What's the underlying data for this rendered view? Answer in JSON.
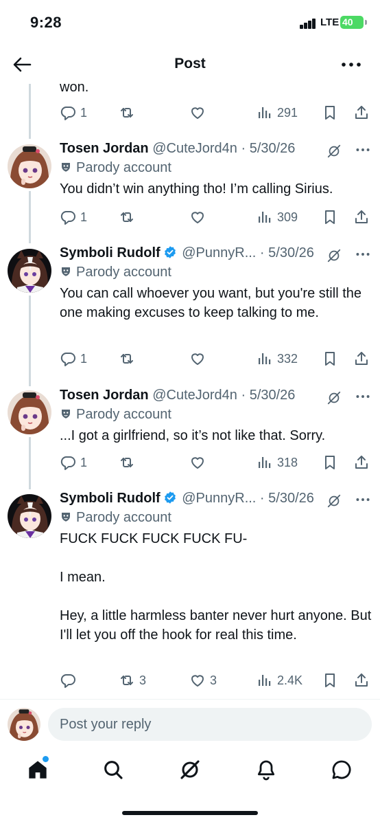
{
  "status_bar": {
    "time": "9:28",
    "network": "LTE",
    "battery": "40"
  },
  "header": {
    "title": "Post"
  },
  "previous_tweet": {
    "text_tail": "won.",
    "actions": {
      "replies": "1",
      "retweets": "",
      "likes": "",
      "views": "291"
    }
  },
  "tweets": [
    {
      "name": "Tosen Jordan",
      "handle": "@CuteJord4n",
      "date": "· 5/30/26",
      "parody": "Parody account",
      "text": "You didn’t win anything tho! I’m calling Sirius.",
      "verified": false,
      "actions": {
        "replies": "1",
        "retweets": "",
        "likes": "",
        "views": "309"
      }
    },
    {
      "name": "Symboli Rudolf",
      "handle": "@PunnyR...",
      "date": "· 5/30/26",
      "parody": "Parody account",
      "text": "You can call whoever you want, but you're still the one making excuses to keep talking to me.",
      "verified": true,
      "actions": {
        "replies": "1",
        "retweets": "",
        "likes": "",
        "views": "332"
      }
    },
    {
      "name": "Tosen Jordan",
      "handle": "@CuteJord4n",
      "date": "· 5/30/26",
      "parody": "Parody account",
      "text": "...I got a girlfriend, so it’s not like that. Sorry.",
      "verified": false,
      "actions": {
        "replies": "1",
        "retweets": "",
        "likes": "",
        "views": "318"
      }
    },
    {
      "name": "Symboli Rudolf",
      "handle": "@PunnyR...",
      "date": "· 5/30/26",
      "parody": "Parody account",
      "text": "FUCK FUCK FUCK FUCK FU-\n\nI mean.\n\nHey, a little harmless banter never hurt anyone. But I'll let you off the hook for real this time.",
      "verified": true,
      "actions": {
        "replies": "",
        "retweets": "3",
        "likes": "3",
        "views": "2.4K"
      }
    }
  ],
  "reply_bar": {
    "placeholder": "Post your reply"
  },
  "tab_bar": [
    "home-icon",
    "search-icon",
    "grok-icon",
    "notifications-icon",
    "messages-icon"
  ],
  "colors": {
    "accent": "#1d9bf0",
    "muted": "#536471",
    "text": "#0f1419",
    "thread_line": "#cfd9de",
    "battery": "#4cd964"
  }
}
